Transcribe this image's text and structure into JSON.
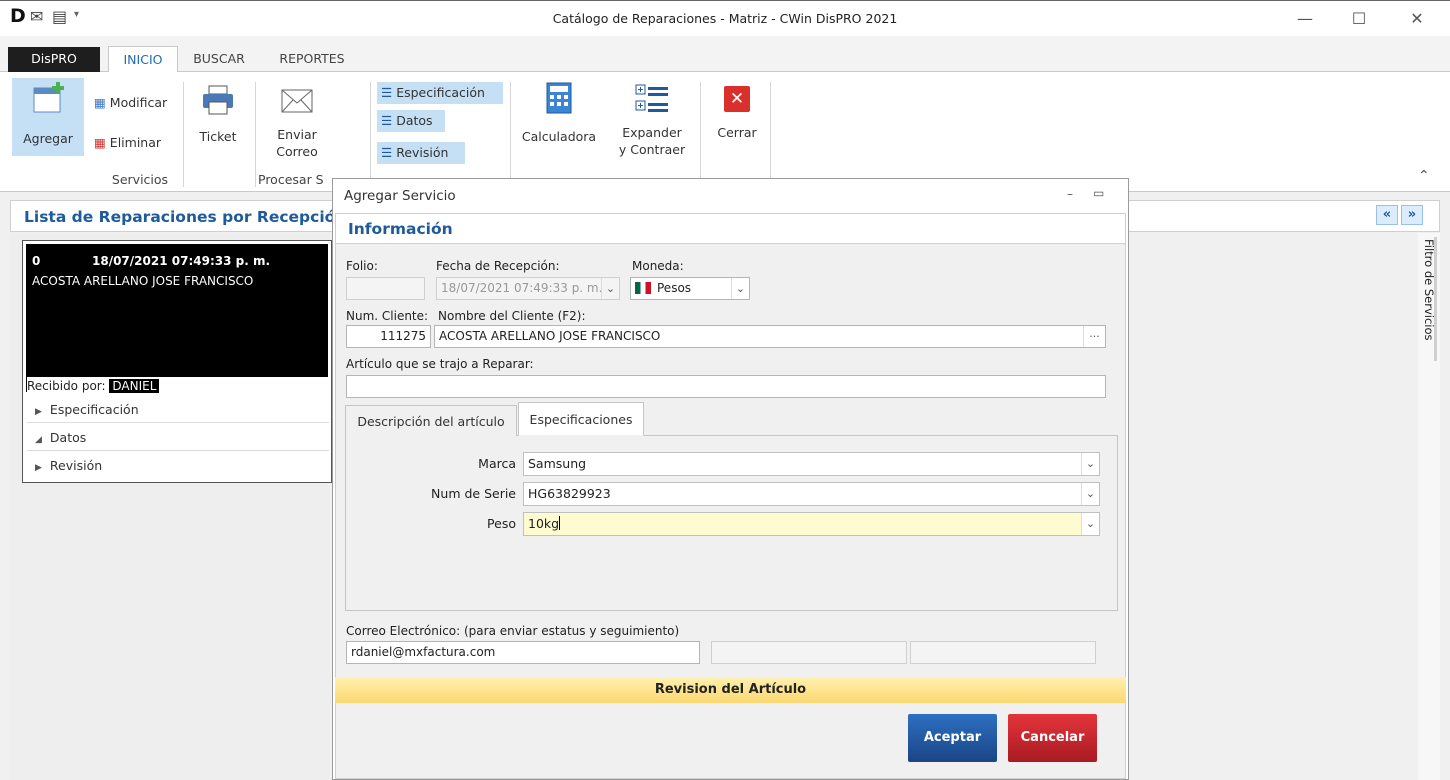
{
  "window": {
    "title": "Catálogo de Reparaciones - Matriz - CWin DisPRO 2021"
  },
  "tabs": {
    "dispro": "DisPRO",
    "inicio": "INICIO",
    "buscar": "BUSCAR",
    "reportes": "REPORTES"
  },
  "ribbon": {
    "agregar": "Agregar",
    "modificar": "Modificar",
    "eliminar": "Eliminar",
    "ticket": "Ticket",
    "enviar_correo_1": "Enviar",
    "enviar_correo_2": "Correo",
    "especificacion": "Especificación",
    "datos": "Datos",
    "revision": "Revisión",
    "calculadora": "Calculadora",
    "expander_1": "Expander",
    "expander_2": "y Contraer",
    "cerrar": "Cerrar",
    "group_servicios": "Servicios",
    "group_procesar": "Procesar S"
  },
  "left": {
    "header": "Lista de Reparaciones por Recepció",
    "card": {
      "folio": "0",
      "datetime": "18/07/2021 07:49:33 p. m.",
      "client": "ACOSTA ARELLANO JOSE FRANCISCO",
      "received_label": "Recibido por:",
      "received_by": "DANIEL"
    },
    "sections": [
      "Especificación",
      "Datos",
      "Revisión"
    ]
  },
  "right": {
    "filter_label": "Filtro de Servicios"
  },
  "dialog": {
    "title": "Agregar Servicio",
    "section": "Información",
    "folio_label": "Folio:",
    "folio_value": "",
    "fecha_label": "Fecha de Recepción:",
    "fecha_value": "18/07/2021 07:49:33 p. m.",
    "moneda_label": "Moneda:",
    "moneda_value": "Pesos",
    "num_cliente_label": "Num. Cliente:",
    "num_cliente_value": "111275",
    "nombre_label": "Nombre del Cliente (F2):",
    "nombre_value": "ACOSTA ARELLANO JOSE FRANCISCO",
    "articulo_label": "Artículo que se trajo a Reparar:",
    "articulo_value": "",
    "tab_descripcion": "Descripción del artículo",
    "tab_especificaciones": "Especificaciones",
    "specs": [
      {
        "label": "Marca",
        "value": "Samsung"
      },
      {
        "label": "Num de Serie",
        "value": "HG63829923"
      },
      {
        "label": "Peso",
        "value": "10kg"
      }
    ],
    "email_label": "Correo Electrónico: (para enviar estatus y seguimiento)",
    "email_value": "rdaniel@mxfactura.com",
    "revision_bar": "Revision del Artículo",
    "aceptar": "Aceptar",
    "cancelar": "Cancelar"
  },
  "colors": {
    "accent": "#1c6bb4",
    "accept": "#1f4f8f",
    "cancel": "#c0222a",
    "revision_bar": "#fde38a"
  }
}
